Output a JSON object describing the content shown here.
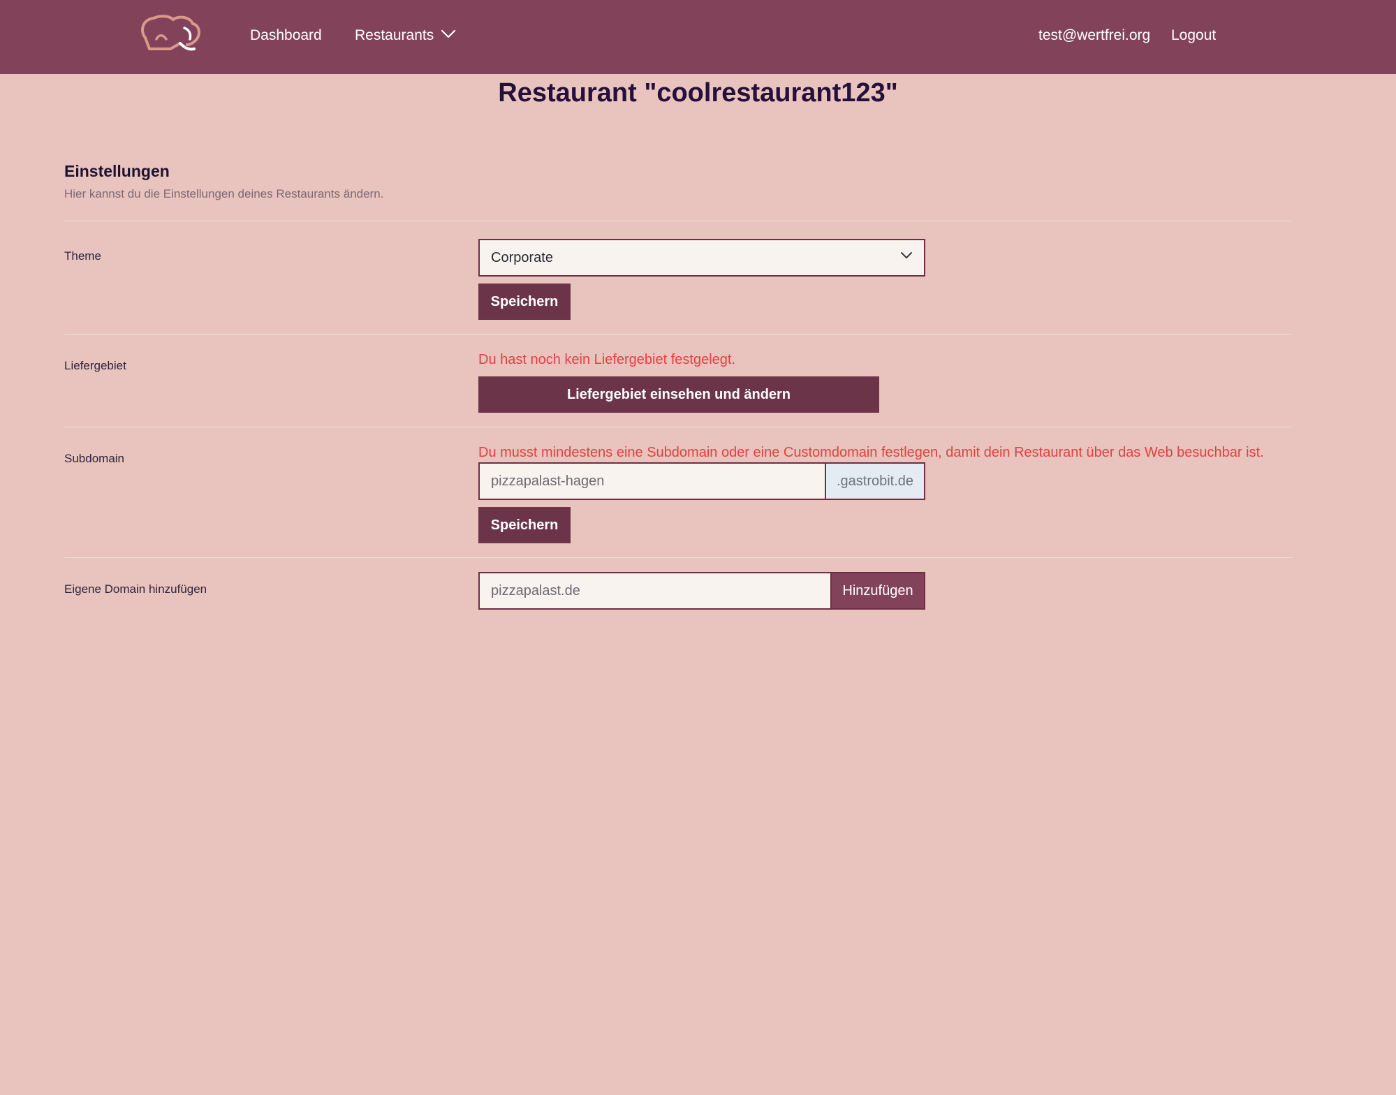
{
  "header": {
    "nav": {
      "dashboard": "Dashboard",
      "restaurants": "Restaurants"
    },
    "user_email": "test@wertfrei.org",
    "logout": "Logout",
    "colors": {
      "bar": "#82435a",
      "logo": "#d99a8a"
    }
  },
  "page": {
    "title": "Restaurant \"coolrestaurant123\""
  },
  "settings": {
    "title": "Einstellungen",
    "subtitle": "Hier kannst du die Einstellungen deines Restaurants ändern.",
    "theme": {
      "label": "Theme",
      "selected": "Corporate",
      "save": "Speichern"
    },
    "liefergebiet": {
      "label": "Liefergebiet",
      "warning": "Du hast noch kein Liefergebiet festgelegt.",
      "button": "Liefergebiet einsehen und ändern"
    },
    "subdomain": {
      "label": "Subdomain",
      "warning": "Du musst mindestens eine Subdomain oder eine Customdomain festlegen, damit dein Restaurant über das Web besuchbar ist.",
      "placeholder": "pizzapalast-hagen",
      "suffix": ".gastrobit.de",
      "save": "Speichern"
    },
    "custom_domain": {
      "label": "Eigene Domain hinzufügen",
      "placeholder": "pizzapalast.de",
      "button": "Hinzufügen"
    }
  },
  "colors": {
    "background": "#e9c3bd",
    "button": "#6b3449",
    "error": "#e0413f",
    "border": "#6e2f45"
  }
}
